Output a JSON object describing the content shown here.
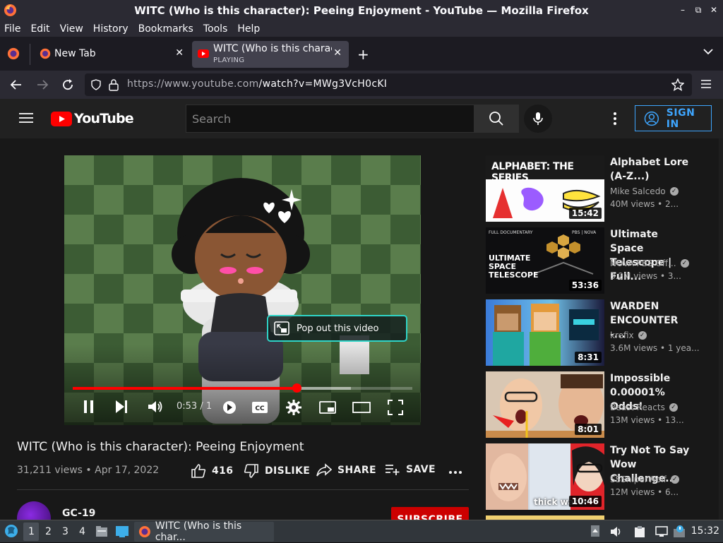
{
  "window": {
    "title": "WITC (Who is this character): Peeing Enjoyment - YouTube — Mozilla Firefox",
    "controls": [
      "–",
      "⧉",
      "✕"
    ]
  },
  "menu": [
    {
      "label": "File"
    },
    {
      "label": "Edit"
    },
    {
      "label": "View"
    },
    {
      "label": "History"
    },
    {
      "label": "Bookmarks"
    },
    {
      "label": "Tools"
    },
    {
      "label": "Help"
    }
  ],
  "tabs": [
    {
      "label": "New Tab"
    },
    {
      "label": "WITC (Who is this charac",
      "status": "PLAYING"
    }
  ],
  "nav": {
    "url_host": "https://www.youtube.com",
    "url_path": "/watch?v=MWg3VcH0cKI"
  },
  "yt": {
    "logo": "YouTube",
    "search_placeholder": "Search",
    "signin": "SIGN IN"
  },
  "player": {
    "popout_label": "Pop out this video",
    "time": "0:53 / 1",
    "progress_pct": 66,
    "buffered_pct": 82
  },
  "video": {
    "title": "WITC (Who is this character): Peeing Enjoyment",
    "meta": "31,211 views • Apr 17, 2022",
    "likes": "416",
    "dislike": "DISLIKE",
    "share": "SHARE",
    "save": "SAVE",
    "channel": "GC-19",
    "subscribe": "SUBSCRIBE"
  },
  "recs": [
    {
      "title": "Alphabet Lore (A-Z...)",
      "channel": "Mike Salcedo",
      "views": "40M views • 2...",
      "duration": "15:42",
      "thumb_text": "ALPHABET: THE SERIES"
    },
    {
      "title": "Ultimate Space Telescope | Full...",
      "channel": "NOVA PBS Off...",
      "views": "3.2M views • 3...",
      "duration": "53:36",
      "thumb_text": "ULTIMATE SPACE TELESCOPE",
      "thumb_tag": "FULL DOCUMENTARY",
      "thumb_brand": "PBS | NOVA"
    },
    {
      "title": "WARDEN ENCOUNTER -...",
      "channel": "krefix",
      "views": "3.6M views • 1 yea...",
      "duration": "8:31"
    },
    {
      "title": "Impossible 0.00001% Odds!",
      "channel": "Beast Reacts",
      "views": "13M views • 13...",
      "duration": "8:01"
    },
    {
      "title": "Try Not To Say Wow Challenge...",
      "channel": "SSSniperWolf",
      "views": "12M views • 6...",
      "duration": "10:46",
      "thumb_text": "thick water"
    }
  ],
  "taskbar": {
    "workspaces": [
      "1",
      "2",
      "3",
      "4"
    ],
    "task_label": "WITC (Who is this char...",
    "clock": "15:32"
  }
}
